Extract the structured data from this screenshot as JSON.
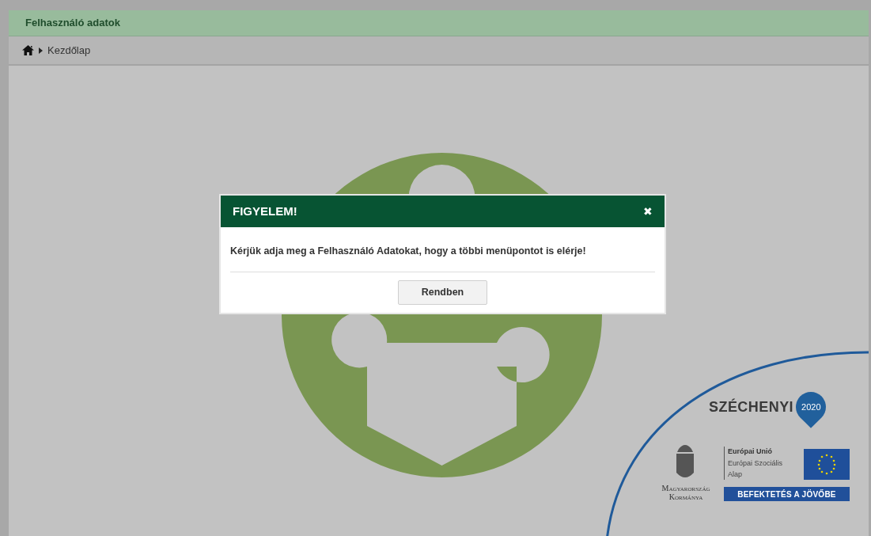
{
  "header": {
    "title": "Felhasználó adatok"
  },
  "breadcrumb": {
    "items": [
      "Kezdőlap"
    ]
  },
  "dialog": {
    "title": "FIGYELEM!",
    "close": "✖",
    "message": "Kérjük adja meg a Felhasználó Adatokat, hogy a többi menüpontot is elérje!",
    "buttons": [
      "Rendben"
    ]
  },
  "funding_logo": {
    "program": "SZÉCHENYI",
    "year": "2020",
    "eu_title": "Európai Unió",
    "eu_fund": "Európai Szociális Alap",
    "government": "Magyarország Kormánya",
    "slogan": "BEFEKTETÉS A JÖVŐBE"
  }
}
